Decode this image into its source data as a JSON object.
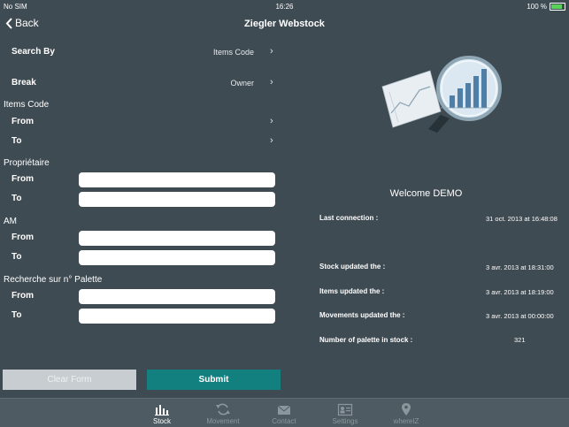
{
  "status": {
    "carrier": "No SIM",
    "time": "16:26",
    "battery": "100 %",
    "battery_level": 1.0
  },
  "nav": {
    "back": "Back",
    "title": "Ziegler Webstock"
  },
  "form": {
    "search_by": {
      "label": "Search By",
      "value": "Items Code"
    },
    "break": {
      "label": "Break",
      "value": "Owner"
    },
    "items_code": {
      "title": "Items Code",
      "from": "From",
      "to": "To"
    },
    "proprietaire": {
      "title": "Propriétaire",
      "from": "From",
      "to": "To",
      "from_value": "",
      "to_value": ""
    },
    "am": {
      "title": "AM",
      "from": "From",
      "to": "To",
      "from_value": "",
      "to_value": ""
    },
    "palette": {
      "title": "Recherche sur n° Palette",
      "from": "From",
      "to": "To",
      "from_value": "",
      "to_value": ""
    },
    "clear_label": "Clear Form",
    "submit_label": "Submit"
  },
  "info": {
    "welcome": "Welcome DEMO",
    "last_connection_label": "Last connection :",
    "last_connection_value": "31 oct. 2013 at 16:48:08",
    "stock_label": "Stock updated the :",
    "stock_value": "3 avr. 2013 at 18:31:00",
    "items_label": "Items updated the :",
    "items_value": "3 avr. 2013 at 18:19:00",
    "movements_label": "Movements updated the :",
    "movements_value": "3 avr. 2013 at 00:00:00",
    "palette_count_label": "Number of palette in stock :",
    "palette_count_value": "321"
  },
  "tabs": [
    {
      "label": "Stock",
      "icon": "bar-chart-icon",
      "active": true
    },
    {
      "label": "Movement",
      "icon": "refresh-icon",
      "active": false
    },
    {
      "label": "Contact",
      "icon": "envelope-icon",
      "active": false
    },
    {
      "label": "Settings",
      "icon": "id-card-icon",
      "active": false
    },
    {
      "label": "whereIZ",
      "icon": "map-pin-icon",
      "active": false
    }
  ]
}
